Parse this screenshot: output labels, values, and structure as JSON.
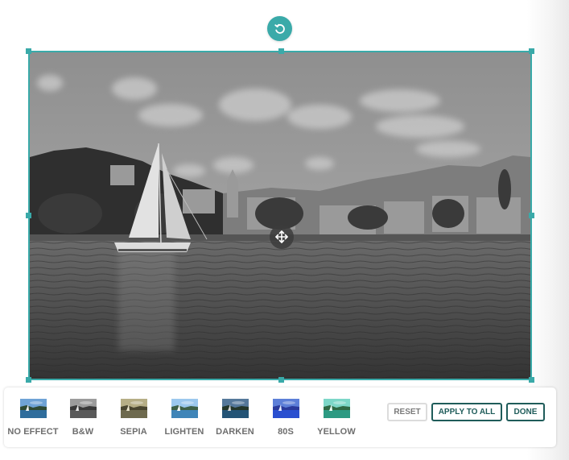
{
  "editor": {
    "rotate_icon": "rotate-icon",
    "move_icon": "move-icon",
    "image": {
      "description": "Harbor town with sailboat, mountains and water",
      "current_effect": "B&W"
    }
  },
  "effects_panel": {
    "effects": [
      {
        "label": "NO EFFECT",
        "tint": "none"
      },
      {
        "label": "B&W",
        "tint": "grayscale"
      },
      {
        "label": "SEPIA",
        "tint": "sepia"
      },
      {
        "label": "LIGHTEN",
        "tint": "lighten"
      },
      {
        "label": "DARKEN",
        "tint": "darken"
      },
      {
        "label": "80S",
        "tint": "blue"
      },
      {
        "label": "YELLOW",
        "tint": "teal"
      }
    ],
    "buttons": {
      "reset": "RESET",
      "apply_to_all": "APPLY TO ALL",
      "done": "DONE"
    }
  },
  "colors": {
    "accent": "#3aaaa9",
    "button_border": "#1f5c5a",
    "label": "#6e6e6e"
  }
}
